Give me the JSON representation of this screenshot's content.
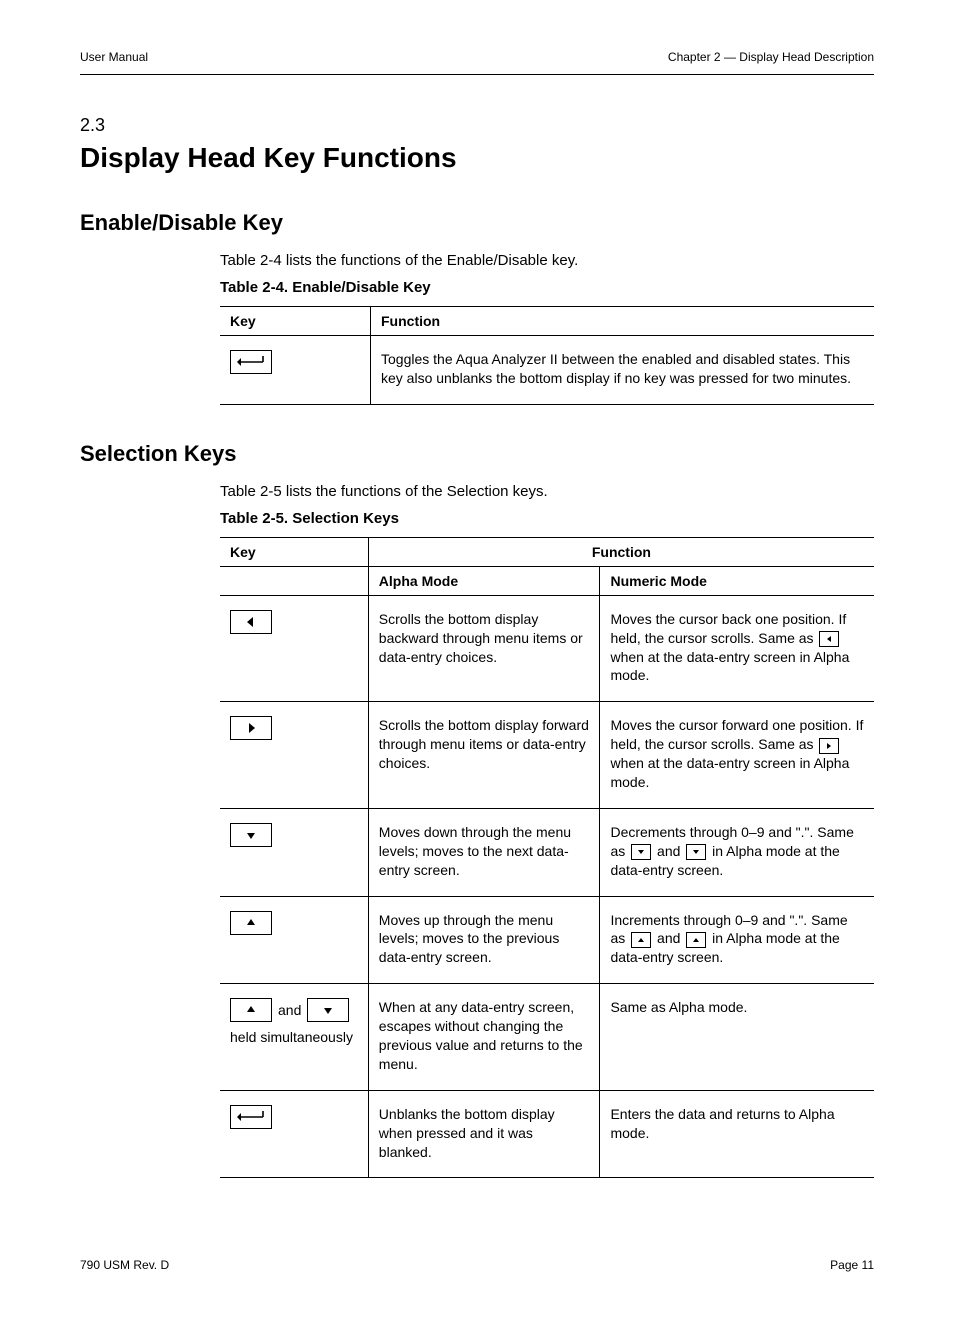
{
  "header": {
    "left": "User Manual",
    "right": "Chapter 2 — Display Head Description"
  },
  "chapter": {
    "number": "2.3",
    "title": "Display Head Key Functions"
  },
  "section1": {
    "title": "Enable/Disable Key",
    "intro": "Table 2-4 lists the functions of the Enable/Disable key.",
    "table_label": "Table 2-4. Enable/Disable Key",
    "head_key": "Key",
    "head_func": "Function",
    "row_func": "Toggles the Aqua Analyzer II between the enabled and disabled states. This key also unblanks the bottom display if no key was pressed for two minutes."
  },
  "section2": {
    "title": "Selection Keys",
    "intro": "Table 2-5 lists the functions of the Selection keys.",
    "table_label": "Table 2-5. Selection Keys",
    "head_key": "Key",
    "head_alpha": "Alpha Mode",
    "head_num": "Numeric Mode",
    "rows": [
      {
        "alpha": "Scrolls the bottom display backward through menu items or data-entry choices.",
        "num": "Moves the cursor back one position. If held, the cursor scrolls. Same as ▶ when at the data-entry screen in Alpha mode."
      },
      {
        "alpha": "Scrolls the bottom display forward through menu items or data-entry choices.",
        "num": "Moves the cursor forward one position. If held, the cursor scrolls. Same as ◀ when at the data-entry screen in Alpha mode."
      },
      {
        "alpha": "Moves down through the menu levels; moves to the next data-entry screen.",
        "num": "Decrements through 0–9 and \".\". Same as ▲ and ▼ in Alpha mode at the data-entry screen."
      },
      {
        "alpha": "Moves up through the menu levels; moves to the previous data-entry screen.",
        "num": "Increments through 0–9 and \".\". Same as ▲ and ▼ in Alpha mode at the data-entry screen."
      },
      {
        "held_prefix": "and",
        "held_suffix": "held simultaneously",
        "alpha": "When at any data-entry screen, escapes without changing the previous value and returns to the menu.",
        "num": "Same as Alpha mode."
      },
      {
        "alpha": "Unblanks the bottom display when pressed and it was blanked.",
        "num": "Enters the data and returns to Alpha mode."
      }
    ]
  },
  "footer": {
    "left": "790 USM Rev. D",
    "right": "Page 11"
  }
}
